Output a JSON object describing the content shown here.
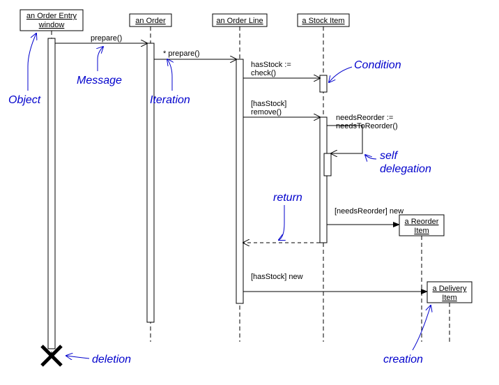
{
  "objects": {
    "entryWindow": {
      "line1": "an Order Entry",
      "line2": "window"
    },
    "order": "an Order",
    "orderLine": "an Order Line",
    "stockItem": "a Stock Item",
    "reorderItem": {
      "line1": "a Reorder",
      "line2": "Item"
    },
    "deliveryItem": {
      "line1": "a Delivery",
      "line2": "Item"
    }
  },
  "messages": {
    "prepare1": "prepare()",
    "prepare2": "* prepare()",
    "hasStockCheck": {
      "line1": "hasStock :=",
      "line2": "check()"
    },
    "hasStockRemove": {
      "line1": "[hasStock]",
      "line2": "remove()"
    },
    "needsReorder": {
      "line1": "needsReorder :=",
      "line2": "needsToReorder()"
    },
    "needsReorderNew": "[needsReorder] new",
    "hasStockNew": "[hasStock] new"
  },
  "annotations": {
    "object": "Object",
    "message": "Message",
    "iteration": "Iteration",
    "condition": "Condition",
    "selfDelegation": {
      "line1": "self",
      "line2": "delegation"
    },
    "ret": "return",
    "deletion": "deletion",
    "creation": "creation"
  }
}
